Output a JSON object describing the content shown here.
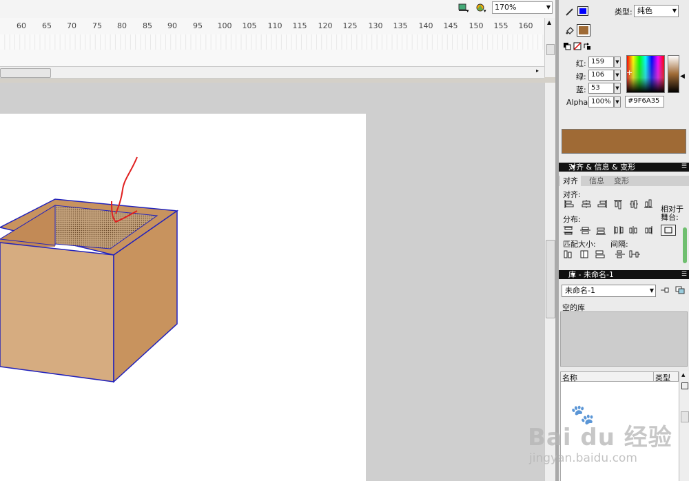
{
  "toolbar": {
    "zoom": "170%"
  },
  "ruler": {
    "ticks": [
      "60",
      "65",
      "70",
      "75",
      "80",
      "85",
      "90",
      "95",
      "100",
      "105",
      "110",
      "115",
      "120",
      "125",
      "130",
      "135",
      "140",
      "145",
      "150",
      "155",
      "160"
    ]
  },
  "color_panel": {
    "type_label": "类型:",
    "type_value": "纯色",
    "red_label": "红:",
    "red": "159",
    "green_label": "绿:",
    "green": "106",
    "blue_label": "蓝:",
    "blue": "53",
    "alpha_label": "Alpha:",
    "alpha": "100%",
    "hex": "#9F6A35",
    "stroke_color": "#0000ff",
    "fill_color": "#9f6a35"
  },
  "align_panel": {
    "header": "对齐 & 信息 & 变形",
    "tabs": [
      "对齐",
      "信息",
      "变形"
    ],
    "align_label": "对齐:",
    "distribute_label": "分布:",
    "match_size_label": "匹配大小:",
    "spacing_label": "间隔:",
    "relative_to_stage": "相对于\n舞台:"
  },
  "library_panel": {
    "header": "库 - 未命名-1",
    "document": "未命名-1",
    "empty_text": "空的库",
    "col_name": "名称",
    "col_type": "类型"
  },
  "watermark": {
    "brand": "Bai du 经验",
    "url": "jingyan.baidu.com"
  }
}
